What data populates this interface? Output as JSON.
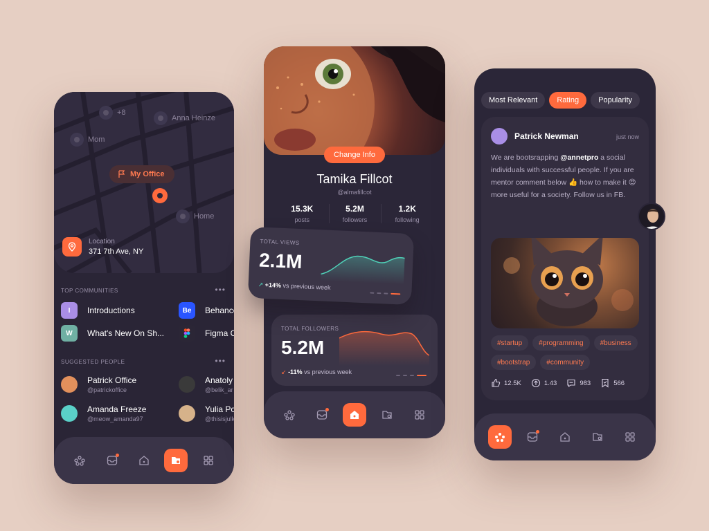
{
  "left": {
    "map": {
      "pins": [
        {
          "label": "+8"
        },
        {
          "label": "Anna Heinze"
        },
        {
          "label": "Mom"
        },
        {
          "label": "Home"
        }
      ],
      "office_label": "My Office"
    },
    "location": {
      "title": "Location",
      "address": "371 7th Ave, NY"
    },
    "communities": {
      "title": "TOP COMMUNITIES",
      "items": [
        {
          "badge": "I",
          "name": "Introductions",
          "color": "#a98ee6"
        },
        {
          "badge": "Be",
          "name": "Behance",
          "color": "#2a55ff"
        },
        {
          "badge": "W",
          "name": "What's New On Sh...",
          "color": "#6fb0a3"
        },
        {
          "badge": "",
          "name": "Figma C",
          "color": "#2b2636"
        }
      ]
    },
    "suggested": {
      "title": "SUGGESTED PEOPLE",
      "items": [
        {
          "name": "Patrick Office",
          "handle": "@patrickoffice",
          "color": "#e2905c"
        },
        {
          "name": "Anatoly",
          "handle": "@belik_ar",
          "color": "#3a3a3a"
        },
        {
          "name": "Amanda Freeze",
          "handle": "@meow_amanda97",
          "color": "#5ad0c8"
        },
        {
          "name": "Yulia Po",
          "handle": "@thisisjulk",
          "color": "#d6b28a"
        }
      ]
    }
  },
  "mid": {
    "change_info": "Change Info",
    "name": "Tamika Fillcot",
    "handle": "@almafillcot",
    "stats": [
      {
        "value": "15.3K",
        "label": "posts"
      },
      {
        "value": "5.2M",
        "label": "followers"
      },
      {
        "value": "1.2K",
        "label": "following"
      }
    ]
  },
  "cards": {
    "views": {
      "label": "TOTAL VIEWS",
      "value": "2.1M",
      "delta": "+14%",
      "delta_text": "vs previous week",
      "color": "#4fd1b8"
    },
    "followers": {
      "label": "TOTAL FOLLOWERS",
      "value": "5.2M",
      "delta": "-11%",
      "delta_text": "vs previous week",
      "color": "#ff6a3d"
    }
  },
  "right": {
    "filters": [
      {
        "label": "Most Relevant",
        "active": false
      },
      {
        "label": "Rating",
        "active": true
      },
      {
        "label": "Popularity",
        "active": false
      }
    ],
    "post": {
      "author": "Patrick Newman",
      "time": "just now",
      "text_before": "We are bootsrapping ",
      "mention": "@annetpro",
      "text_after": " a social individuals with successful people. If you are mentor comment below 👍 how to make it 😍 more useful for a society. Follow us in FB.",
      "tags": [
        "#startup",
        "#programming",
        "#business",
        "#bootstrap",
        "#community"
      ],
      "reactions": [
        {
          "icon": "like-icon",
          "count": "12.5K"
        },
        {
          "icon": "upvote-icon",
          "count": "1.43"
        },
        {
          "icon": "comment-icon",
          "count": "983"
        },
        {
          "icon": "bookmark-icon",
          "count": "566"
        }
      ]
    }
  },
  "colors": {
    "accent": "#ff6a3d",
    "bg": "#e6cfc3",
    "phone": "#2b2638"
  }
}
